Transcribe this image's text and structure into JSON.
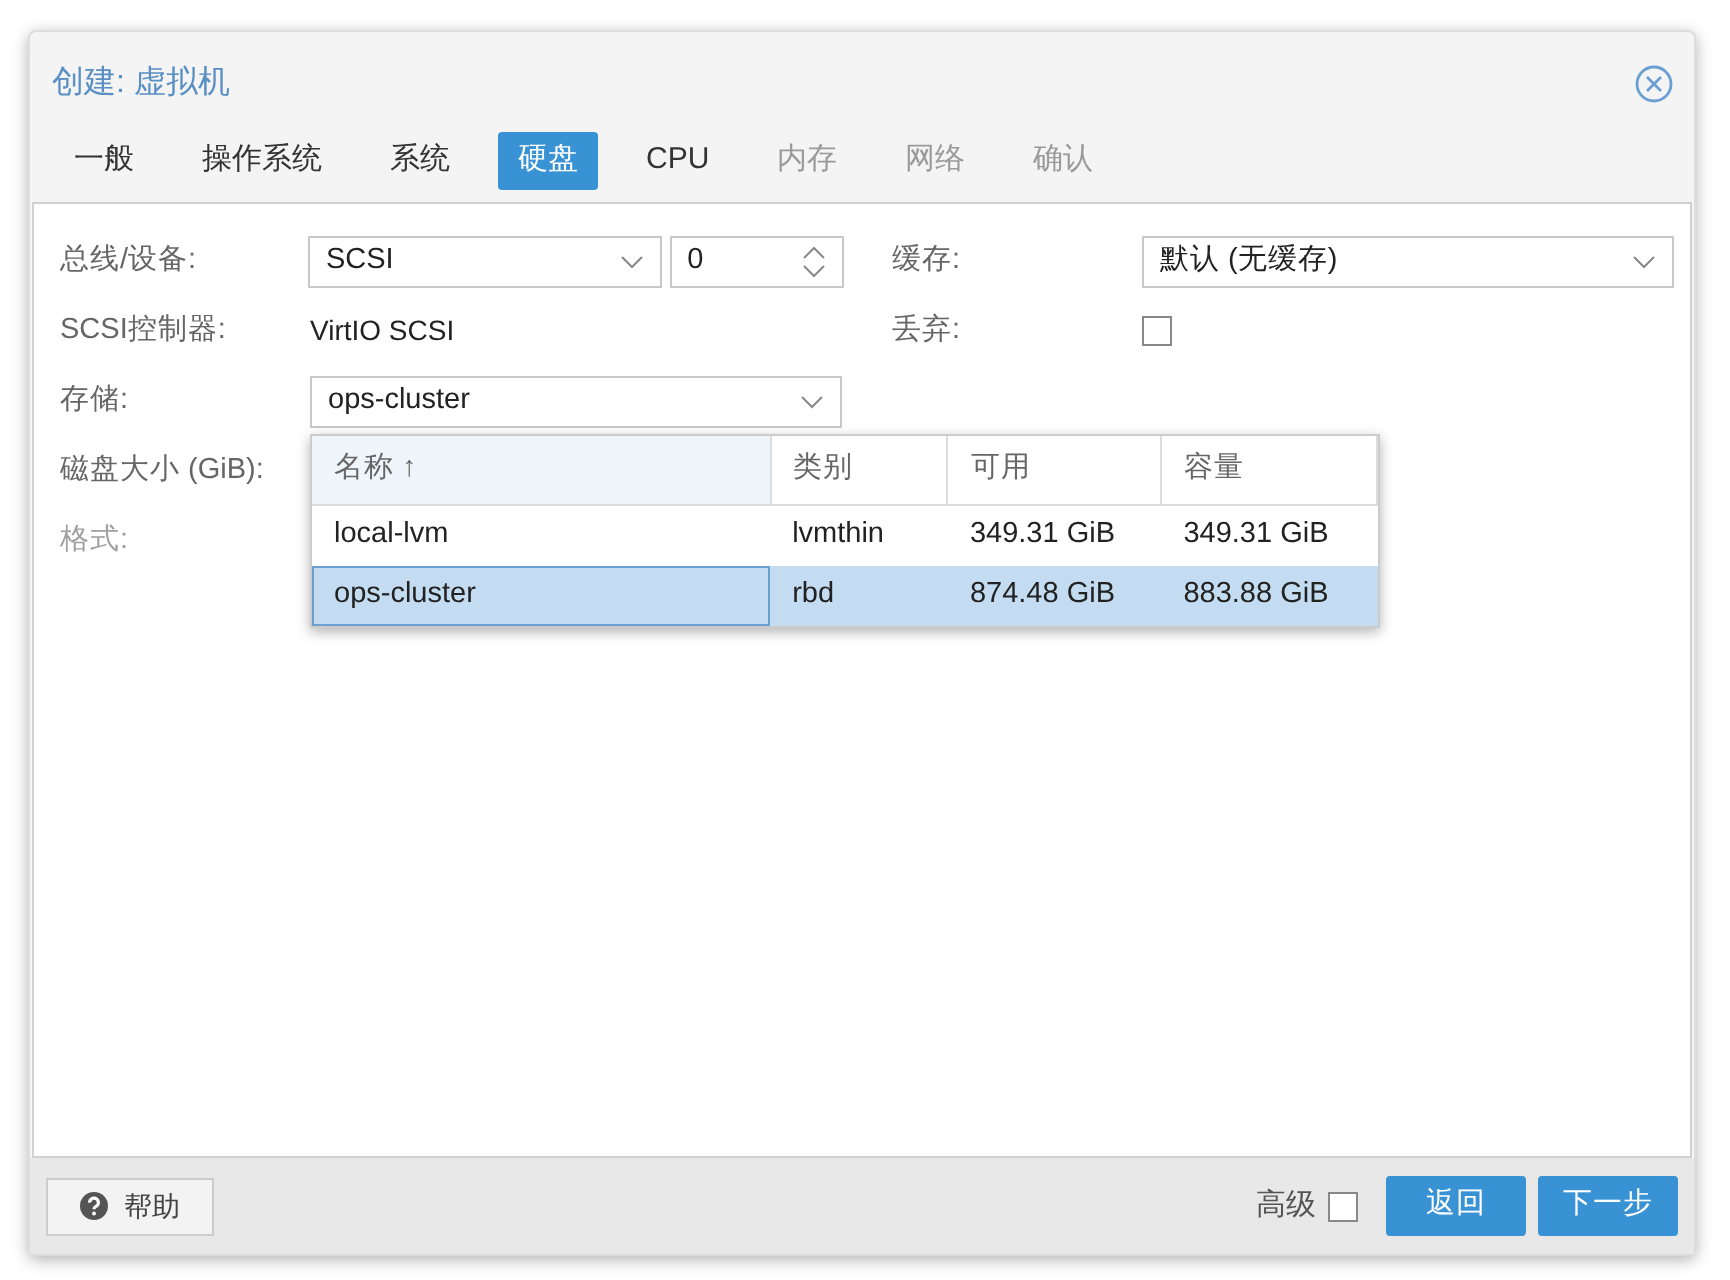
{
  "window": {
    "title": "创建: 虚拟机"
  },
  "tabs": [
    {
      "label": "一般",
      "selected": false,
      "disabled": false
    },
    {
      "label": "操作系统",
      "selected": false,
      "disabled": false
    },
    {
      "label": "系统",
      "selected": false,
      "disabled": false
    },
    {
      "label": "硬盘",
      "selected": true,
      "disabled": false
    },
    {
      "label": "CPU",
      "selected": false,
      "disabled": false
    },
    {
      "label": "内存",
      "selected": false,
      "disabled": true
    },
    {
      "label": "网络",
      "selected": false,
      "disabled": true
    },
    {
      "label": "确认",
      "selected": false,
      "disabled": true
    }
  ],
  "left_fields": [
    {
      "kind": "select-spinner",
      "label": "总线/设备:",
      "value": "SCSI",
      "spinner_value": "0",
      "disabled": false
    },
    {
      "kind": "text",
      "label": "SCSI控制器:",
      "value": "VirtIO SCSI",
      "disabled": false
    },
    {
      "kind": "select-open",
      "label": "存储:",
      "value": "ops-cluster",
      "disabled": false
    },
    {
      "kind": "hidden",
      "label": "磁盘大小 (GiB):",
      "disabled": false
    },
    {
      "kind": "hidden",
      "label": "格式:",
      "disabled": true
    }
  ],
  "right_fields": [
    {
      "kind": "select",
      "label": "缓存:",
      "value": "默认 (无缓存)"
    },
    {
      "kind": "checkbox",
      "label": "丢弃:",
      "checked": false
    }
  ],
  "storage_dropdown": {
    "columns": [
      {
        "label": "名称",
        "sort_indicator": "↑"
      },
      {
        "label": "类别"
      },
      {
        "label": "可用"
      },
      {
        "label": "容量"
      }
    ],
    "rows": [
      {
        "cells": [
          "local-lvm",
          "lvmthin",
          "349.31 GiB",
          "349.31 GiB"
        ],
        "selected": false
      },
      {
        "cells": [
          "ops-cluster",
          "rbd",
          "874.48 GiB",
          "883.88 GiB"
        ],
        "selected": true
      }
    ]
  },
  "footer": {
    "help_button": "帮助",
    "advanced": {
      "label": "高级",
      "checked": false
    },
    "back_button": "返回",
    "next_button": "下一步"
  }
}
